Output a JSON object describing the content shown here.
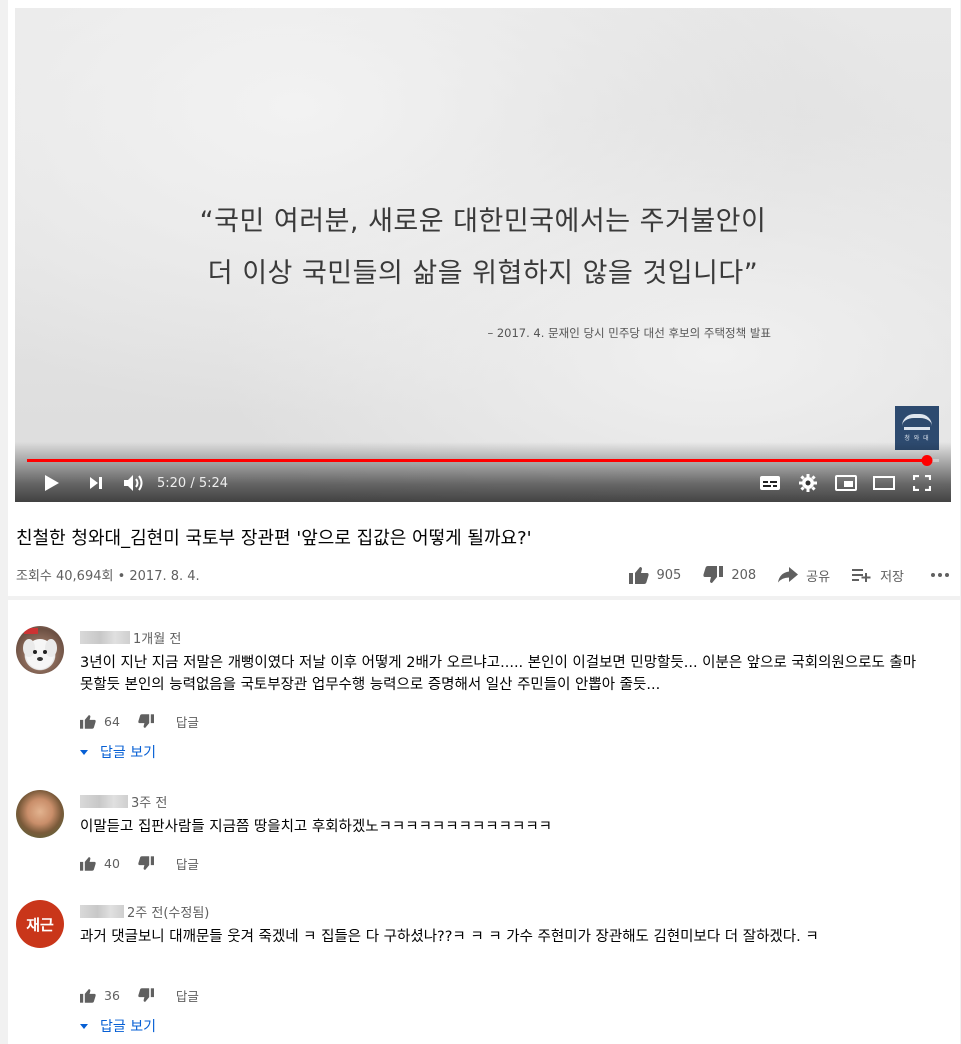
{
  "player": {
    "quote_line1": "“국민 여러분, 새로운 대한민국에서는 주거불안이",
    "quote_line2": "더 이상 국민들의 삶을 위협하지 않을 것입니다”",
    "quote_source": "– 2017. 4. 문재인 당시 민주당 대선 후보의 주택정책 발표",
    "logo_text": "청 와 대",
    "time": "5:20 / 5:24",
    "progress": 0.987,
    "accent_color": "#ff0000"
  },
  "video": {
    "title": "친철한 청와대_김현미 국토부 장관편 '앞으로 집값은 어떻게 될까요?'",
    "meta": "조회수 40,694회 • 2017. 8. 4.",
    "likes": "905",
    "dislikes": "208",
    "share_label": "공유",
    "save_label": "저장"
  },
  "comments": [
    {
      "time": "1개월 전",
      "text": "3년이 지난 지금 저말은 개뻥이였다 저날 이후 어떻게 2배가 오르냐고..... 본인이 이걸보면 민망할듯... 이분은 앞으로 국회의원으로도 출마 못할듯 본인의 능력없음을 국토부장관 업무수행 능력으로 증명해서 일산 주민들이 안뽑아 줄듯...",
      "likes": "64",
      "reply_label": "답글",
      "view_replies": "답글 보기"
    },
    {
      "time": "3주 전",
      "text": "이말듣고 집판사람들 지금쯤 땅을치고 후회하겠노ㅋㅋㅋㅋㅋㅋㅋㅋㅋㅋㅋㅋㅋ",
      "likes": "40",
      "reply_label": "답글"
    },
    {
      "time": "2주 전(수정됨)",
      "avatar_text": "재근",
      "avatar_color": "#c9361a",
      "text": "과거 댓글보니 대깨문들 웃겨 죽겠네 ㅋ 집들은 다 구하셨나??ㅋ ㅋ ㅋ 가수 주현미가 장관해도 김현미보다 더 잘하겠다. ㅋ",
      "likes": "36",
      "reply_label": "답글",
      "view_replies": "답글 보기"
    }
  ]
}
